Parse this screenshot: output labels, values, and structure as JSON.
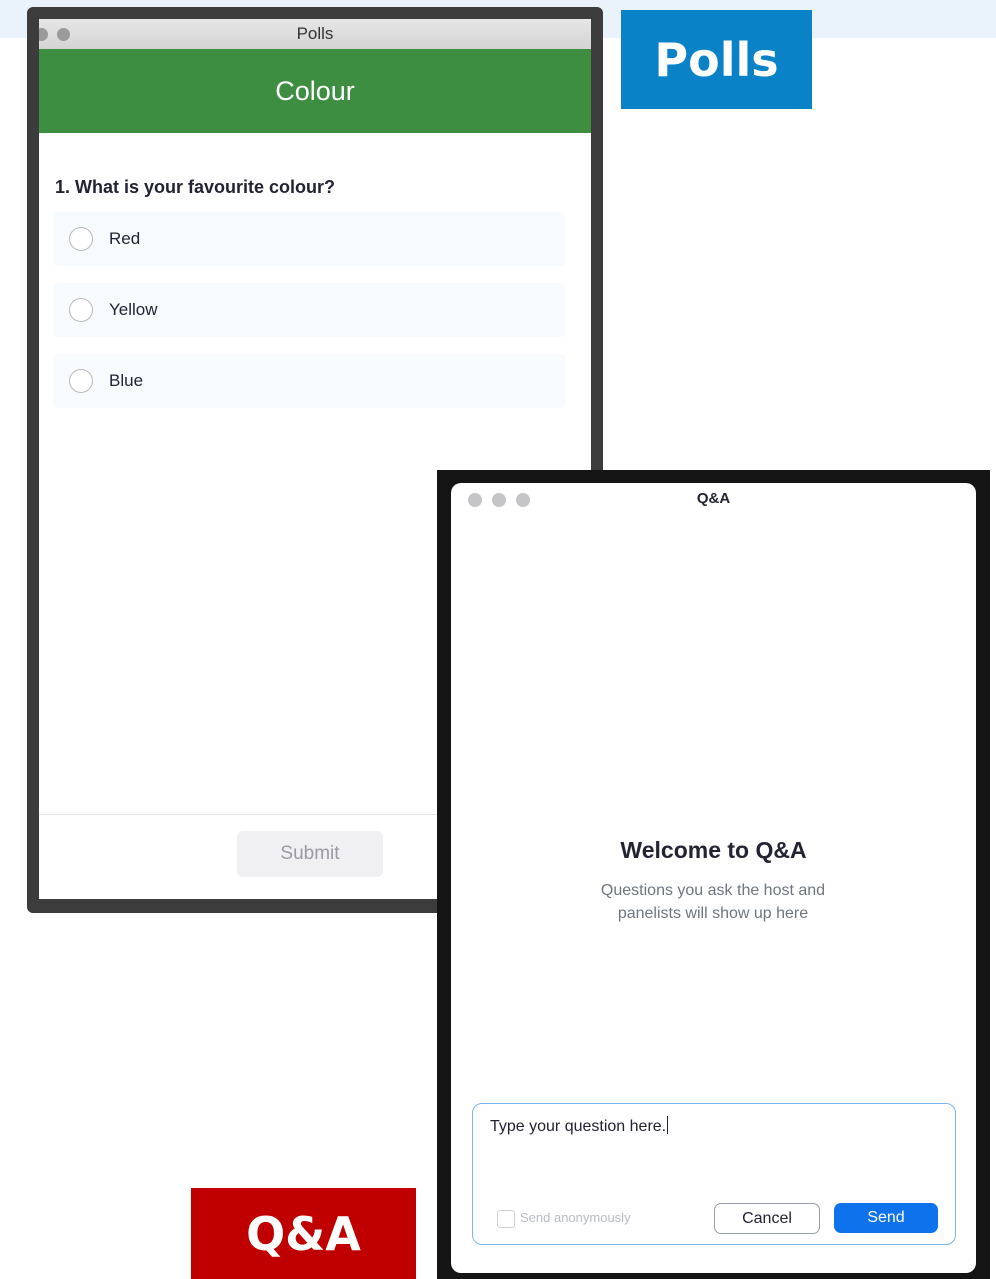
{
  "labels": {
    "polls_badge": "Polls",
    "qa_badge": "Q&A"
  },
  "polls": {
    "window_title": "Polls",
    "header": "Colour",
    "question": "1. What is your favourite colour?",
    "options": [
      {
        "label": "Red"
      },
      {
        "label": "Yellow"
      },
      {
        "label": "Blue"
      }
    ],
    "submit_label": "Submit"
  },
  "qa": {
    "window_title": "Q&A",
    "welcome_title": "Welcome to Q&A",
    "welcome_line1": "Questions you ask the host and",
    "welcome_line2": "panelists will show up here",
    "input_value": "Type your question here.",
    "anonymous_label": "Send anonymously",
    "cancel_label": "Cancel",
    "send_label": "Send"
  },
  "colors": {
    "polls_badge": "#0a82c8",
    "qa_badge": "#c00000",
    "polls_header": "#3e8e41",
    "send_button": "#0e72ed"
  }
}
